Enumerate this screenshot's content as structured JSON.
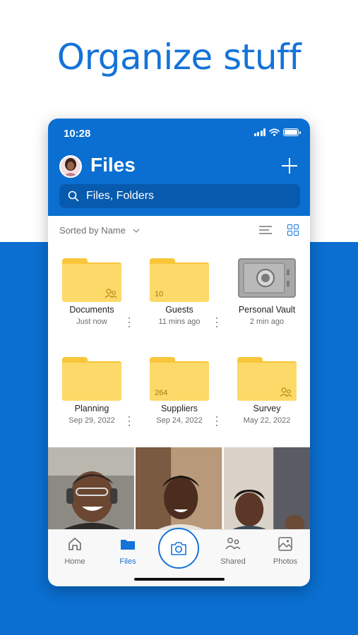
{
  "headline": "Organize stuff",
  "status": {
    "time": "10:28"
  },
  "header": {
    "title": "Files",
    "add_icon": "plus-icon"
  },
  "search": {
    "placeholder": "Files, Folders"
  },
  "sort": {
    "label": "Sorted by Name"
  },
  "items": [
    {
      "name": "Documents",
      "meta": "Just now",
      "kind": "folder",
      "shared": true,
      "count": ""
    },
    {
      "name": "Guests",
      "meta": "11 mins ago",
      "kind": "folder",
      "shared": false,
      "count": "10"
    },
    {
      "name": "Personal Vault",
      "meta": "2 min ago",
      "kind": "vault",
      "shared": false,
      "count": ""
    },
    {
      "name": "Planning",
      "meta": "Sep 29, 2022",
      "kind": "folder",
      "shared": false,
      "count": ""
    },
    {
      "name": "Suppliers",
      "meta": "Sep 24, 2022",
      "kind": "folder",
      "shared": false,
      "count": "264"
    },
    {
      "name": "Survey",
      "meta": "May 22, 2022",
      "kind": "folder",
      "shared": true,
      "count": ""
    }
  ],
  "tabs": [
    {
      "label": "Home",
      "icon": "home-icon"
    },
    {
      "label": "Files",
      "icon": "folder-icon",
      "active": true
    },
    {
      "label": "Shared",
      "icon": "people-icon"
    },
    {
      "label": "Photos",
      "icon": "photo-icon"
    }
  ],
  "colors": {
    "brand": "#0a6fd1",
    "accent": "#1473d8",
    "folder": "#fcd968"
  }
}
